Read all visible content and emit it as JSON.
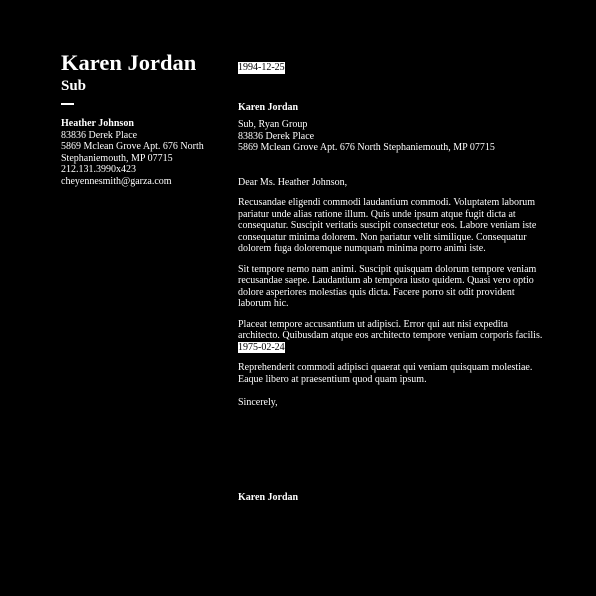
{
  "sender": {
    "name": "Karen Jordan",
    "title": "Sub"
  },
  "recipient": {
    "name": "Heather Johnson",
    "address_line1": "83836 Derek Place",
    "address_line2": "5869 Mclean Grove Apt. 676 North",
    "address_line3": "Stephaniemouth, MP 07715",
    "phone": "212.131.3990x423",
    "email": "cheyennesmith@garza.com"
  },
  "letter": {
    "date": "1994-12-25",
    "from_name": "Karen Jordan",
    "from_company": "Sub, Ryan Group",
    "from_address1": "83836 Derek Place",
    "from_address2": "5869 Mclean Grove Apt. 676 North Stephaniemouth, MP 07715",
    "salutation": "Dear Ms. Heather Johnson,",
    "paragraph1": "Recusandae eligendi commodi laudantium commodi. Voluptatem laborum pariatur unde alias ratione illum. Quis unde ipsum atque fugit dicta at consequatur. Suscipit veritatis suscipit consectetur eos. Labore veniam iste consequatur minima dolorem. Non pariatur velit similique. Consequatur dolorem fuga doloremque numquam minima porro animi iste.",
    "paragraph2": "Sit tempore nemo nam animi. Suscipit quisquam dolorum tempore veniam recusandae saepe. Laudantium ab tempora iusto quidem. Quasi vero optio dolore asperiores molestias quis dicta. Facere porro sit odit provident laborum hic.",
    "paragraph3": "Placeat tempore accusantium ut adipisci. Error qui aut nisi expedita architecto. Quibusdam atque eos architecto tempore veniam corporis facilis.",
    "paragraph3_date": "1975-02-24",
    "paragraph4": "Reprehenderit commodi adipisci quaerat qui veniam quisquam molestiae. Eaque libero at praesentium quod quam ipsum.",
    "closing": "Sincerely,",
    "signature": "Karen Jordan"
  }
}
